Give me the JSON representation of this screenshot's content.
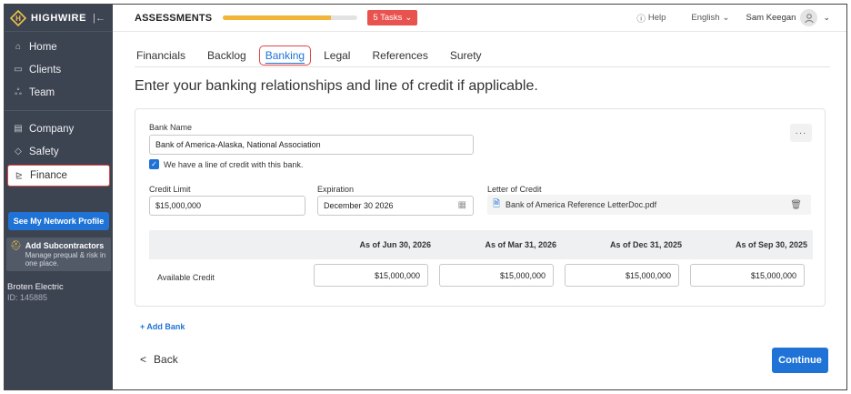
{
  "brand": {
    "name": "HIGHWIRE"
  },
  "sidebar": {
    "items": [
      {
        "label": "Home",
        "icon": "home-icon"
      },
      {
        "label": "Clients",
        "icon": "clients-icon"
      },
      {
        "label": "Team",
        "icon": "team-icon"
      },
      {
        "label": "Company",
        "icon": "company-icon"
      },
      {
        "label": "Safety",
        "icon": "shield-icon"
      },
      {
        "label": "Finance",
        "icon": "finance-icon"
      }
    ],
    "network_button": "See My Network Profile",
    "promo": {
      "title": "Add Subcontractors",
      "subtitle": "Manage prequal & risk in one place."
    },
    "company": {
      "name": "Broten Electric",
      "id": "ID: 145885"
    }
  },
  "topbar": {
    "title": "ASSESSMENTS",
    "progress": 0.8,
    "tasks_label": "5 Tasks",
    "help": "Help",
    "language": "English",
    "user": "Sam Keegan"
  },
  "tabs": [
    "Financials",
    "Backlog",
    "Banking",
    "Legal",
    "References",
    "Surety"
  ],
  "active_tab": "Banking",
  "heading": "Enter your banking relationships and line of credit if applicable.",
  "bank": {
    "name_label": "Bank Name",
    "name_value": "Bank of America-Alaska, National Association",
    "loc_checkbox_label": "We have a line of credit with this bank.",
    "credit_limit_label": "Credit Limit",
    "credit_limit_value": "$15,000,000",
    "expiration_label": "Expiration",
    "expiration_value": "December 30 2026",
    "letter_label": "Letter of Credit",
    "letter_file": "Bank of America Reference LetterDoc.pdf"
  },
  "credit_table": {
    "columns": [
      "As of Jun 30, 2026",
      "As of Mar 31, 2026",
      "As of Dec 31, 2025",
      "As of Sep 30, 2025"
    ],
    "row_label": "Available Credit",
    "values": [
      "$15,000,000",
      "$15,000,000",
      "$15,000,000",
      "$15,000,000"
    ]
  },
  "actions": {
    "add_bank": "+ Add Bank",
    "back": "Back",
    "continue": "Continue"
  },
  "colors": {
    "sidebar": "#3d4451",
    "accent": "#1f73d6",
    "alert": "#e8534f",
    "progress": "#f2b53a",
    "highlight": "#e04646"
  }
}
